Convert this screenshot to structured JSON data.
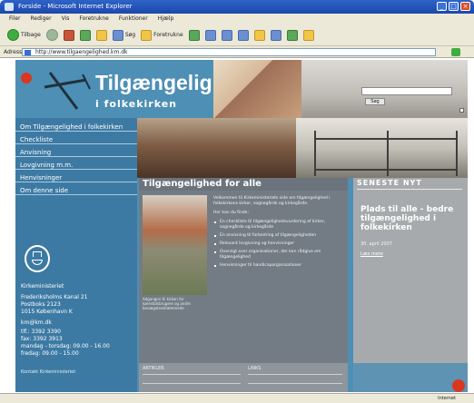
{
  "browser": {
    "window_title": "Forside - Microsoft Internet Explorer",
    "menu": [
      "Filer",
      "Rediger",
      "Vis",
      "Foretrukne",
      "Funktioner",
      "Hjælp"
    ],
    "toolbar": {
      "back_label": "Tilbage",
      "search_label": "Søg",
      "favorites_label": "Foretrukne"
    },
    "address_label": "Adresse",
    "address_value": "http://www.tilgaengelighed.km.dk"
  },
  "site": {
    "title": "Tilgængelighed",
    "subtitle": "i folkekirken",
    "search_button": "Søg"
  },
  "nav": [
    "Om Tilgængelighed i folkekirken",
    "Checkliste",
    "Anvisning",
    "Lovgivning m.m.",
    "Henvisninger",
    "Om denne side"
  ],
  "contact": {
    "org": "Kirkeministeriet",
    "address": [
      "Frederiksholms Kanal 21",
      "Postboks 2123",
      "1015 København K"
    ],
    "email": "km@km.dk",
    "phone": "tlf.: 3392 3390",
    "fax": "fax: 3392 3913",
    "hours": [
      "mandag - torsdag: 09.00 - 16.00",
      "fredag: 09.00 - 15.00"
    ]
  },
  "main": {
    "heading": "Tilgængelighed for alle",
    "photo_caption": "Adgangen til kirken for kørestolsbrugere og andre bevægelseshæmmede",
    "intro": "Velkommen til Kirkeministeriets side om tilgængelighed i folkekirkens kirker, sognegårde og kirkegårde.",
    "lead": "Her kan du finde:",
    "bullets": [
      "En checkliste til tilgængelighedsvurdering af kirker, sognegårde og kirkegårde",
      "En anvisning til forbedring af tilgængeligheden",
      "Relevant lovgivning og henvisninger",
      "Oversigt over organisationer, der kan rådgive om tilgængelighed",
      "Henvisninger til handicaporganisationer"
    ]
  },
  "news": {
    "heading": "SENESTE NYT",
    "title": "Plads til alle - bedre tilgængelighed i folkekirken",
    "date": "30. april 2007",
    "more": "Læs mere"
  },
  "footer": {
    "left": "Kontakt Kirkeministeriet",
    "columns": [
      "ARTIKLER",
      "LINKS"
    ]
  },
  "status": {
    "zone": "Internet"
  }
}
